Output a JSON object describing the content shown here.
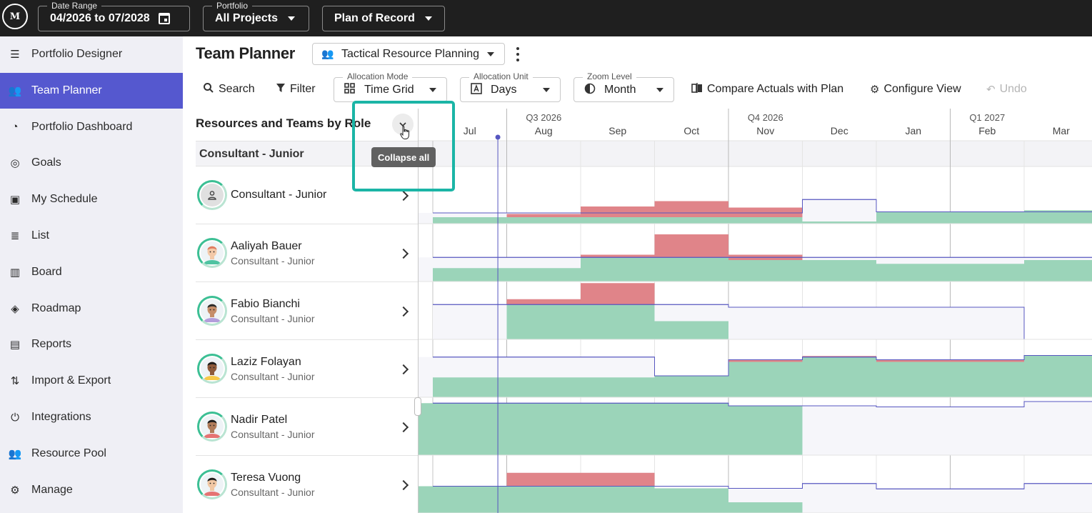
{
  "topbar": {
    "logo": "M",
    "date_range": {
      "legend": "Date Range",
      "value": "04/2026 to 07/2028"
    },
    "portfolio": {
      "legend": "Portfolio",
      "value": "All Projects"
    },
    "plan": {
      "value": "Plan of Record"
    }
  },
  "sidebar": {
    "items": [
      {
        "label": "Portfolio Designer",
        "icon": "tune-icon",
        "glyph": "☰"
      },
      {
        "label": "Team Planner",
        "icon": "team-planner-icon",
        "glyph": "👥"
      },
      {
        "label": "Portfolio Dashboard",
        "icon": "dashboard-icon",
        "glyph": "◔"
      },
      {
        "label": "Goals",
        "icon": "goals-icon",
        "glyph": "◎"
      },
      {
        "label": "My Schedule",
        "icon": "schedule-icon",
        "glyph": "▣"
      },
      {
        "label": "List",
        "icon": "list-icon",
        "glyph": "≣"
      },
      {
        "label": "Board",
        "icon": "board-icon",
        "glyph": "▥"
      },
      {
        "label": "Roadmap",
        "icon": "roadmap-icon",
        "glyph": "◈"
      },
      {
        "label": "Reports",
        "icon": "reports-icon",
        "glyph": "▤"
      },
      {
        "label": "Import & Export",
        "icon": "import-export-icon",
        "glyph": "⇅"
      },
      {
        "label": "Integrations",
        "icon": "integrations-icon",
        "glyph": "⏻"
      },
      {
        "label": "Resource Pool",
        "icon": "resource-pool-icon",
        "glyph": "👥"
      },
      {
        "label": "Manage",
        "icon": "gear-icon",
        "glyph": "⚙"
      }
    ],
    "active_index": 1
  },
  "header": {
    "title": "Team Planner",
    "view": "Tactical Resource Planning"
  },
  "toolbar": {
    "search": "Search",
    "filter": "Filter",
    "allocation_mode": {
      "legend": "Allocation Mode",
      "value": "Time Grid"
    },
    "allocation_unit": {
      "legend": "Allocation Unit",
      "value": "Days"
    },
    "zoom_level": {
      "legend": "Zoom Level",
      "value": "Month"
    },
    "compare": "Compare Actuals with Plan",
    "configure": "Configure View",
    "undo": "Undo"
  },
  "grid": {
    "header": "Resources and Teams by Role",
    "tooltip": "Collapse all",
    "group": "Consultant - Junior",
    "resources": [
      {
        "name": "Consultant - Junior",
        "role": "",
        "placeholder": true
      },
      {
        "name": "Aaliyah Bauer",
        "role": "Consultant - Junior",
        "skin": "#f3c9a8",
        "hair": "#e07a5f",
        "shirt": "#4fc3a1"
      },
      {
        "name": "Fabio Bianchi",
        "role": "Consultant - Junior",
        "skin": "#c68e6a",
        "hair": "#2b2b2b",
        "shirt": "#b39ddb"
      },
      {
        "name": "Laziz Folayan",
        "role": "Consultant - Junior",
        "skin": "#8d5a3b",
        "hair": "#1c1c1c",
        "shirt": "#f7c948"
      },
      {
        "name": "Nadir Patel",
        "role": "Consultant - Junior",
        "skin": "#b07c5a",
        "hair": "#1c1c1c",
        "shirt": "#e57373"
      },
      {
        "name": "Teresa Vuong",
        "role": "Consultant - Junior",
        "skin": "#f1c7a3",
        "hair": "#1c1c1c",
        "shirt": "#e57373"
      }
    ]
  },
  "timeline": {
    "quarters": [
      "Q3 2026",
      "Q4 2026",
      "Q1 2027"
    ],
    "months": [
      "Jul",
      "Aug",
      "Sep",
      "Oct",
      "Nov",
      "Dec",
      "Jan",
      "Feb",
      "Mar"
    ],
    "colors": {
      "available": "#9bd4b9",
      "over": "#e08489",
      "capacity": "#5656c0",
      "empty": "#f6f6fa"
    },
    "rows": [
      {
        "capacity": [
          0.2,
          0.2,
          0.2,
          0.2,
          0.2,
          0.45,
          0.22,
          0.22,
          0.22
        ],
        "alloc": [
          0.12,
          0.12,
          0.12,
          0.12,
          0.12,
          0.04,
          0.22,
          0.22,
          0.25
        ],
        "over": [
          0,
          0.06,
          0.2,
          0.3,
          0.18,
          0,
          0,
          0,
          0
        ]
      },
      {
        "capacity": [
          0.45,
          0.45,
          0.45,
          0.45,
          0.45,
          0.45,
          0.45,
          0.45,
          0.45
        ],
        "alloc": [
          0.25,
          0.25,
          0.45,
          0.45,
          0.4,
          0.4,
          0.33,
          0.33,
          0.4
        ],
        "over": [
          0,
          0,
          0.05,
          0.43,
          0.1,
          0,
          0,
          0,
          0
        ]
      },
      {
        "capacity": [
          0.65,
          0.65,
          0.65,
          0.65,
          0.6,
          0.6,
          0.6,
          0.6,
          0
        ],
        "alloc": [
          0,
          0.65,
          0.65,
          0.34,
          0,
          0,
          0,
          0,
          0
        ],
        "over": [
          0,
          0.1,
          0.4,
          0,
          0,
          0,
          0,
          0,
          0
        ]
      },
      {
        "capacity": [
          0.75,
          0.75,
          0.75,
          0.4,
          0.7,
          0.75,
          0.7,
          0.7,
          0.78
        ],
        "alloc": [
          0.37,
          0.37,
          0.37,
          0.4,
          0.66,
          0.75,
          0.66,
          0.66,
          0.78
        ],
        "over": [
          0,
          0,
          0,
          0,
          0.04,
          0.02,
          0.04,
          0.04,
          0
        ],
        "extraRight": true
      },
      {
        "capacity": [
          0.97,
          0.97,
          0.97,
          0.97,
          0.92,
          0.92,
          0.9,
          0.9,
          1.0
        ],
        "alloc": [
          0.97,
          0.97,
          0.97,
          0.97,
          0.92,
          0,
          0,
          0,
          0
        ],
        "over": [
          0,
          0,
          0,
          0,
          0,
          0,
          0,
          0,
          0
        ]
      },
      {
        "capacity": [
          0.5,
          0.5,
          0.5,
          0.5,
          0.46,
          0.55,
          0.45,
          0.45,
          0.55
        ],
        "alloc": [
          0.5,
          0.5,
          0.5,
          0.46,
          0.2,
          0,
          0,
          0,
          0
        ],
        "over": [
          0,
          0.25,
          0.25,
          0,
          0,
          0,
          0,
          0,
          0
        ]
      }
    ]
  }
}
